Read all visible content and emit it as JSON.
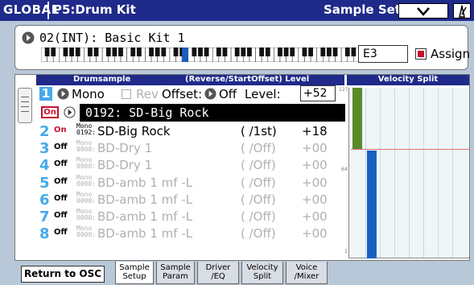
{
  "header": {
    "mode": "GLOBAL",
    "page": "P5:Drum Kit",
    "section": "Sample Setup"
  },
  "kit": {
    "name": "02(INT): Basic Kit 1",
    "key": "E3",
    "assign_label": "Assign"
  },
  "table": {
    "hdr_drumsample": "Drumsample",
    "hdr_reverse": "(Reverse/StartOffset) Level",
    "hdr_velocity": "Velocity Split"
  },
  "row1": {
    "number": "1",
    "mode": "Mono",
    "rev_label": "Rev",
    "offset_label": "Offset:",
    "offset_value": "Off",
    "level_label": "Level:",
    "level_value": "+52",
    "on_label": "On",
    "sample": "0192: SD-Big Rock"
  },
  "rows": [
    {
      "num": "2",
      "state": "On",
      "mode_small": "Mono",
      "id_small": "0192:",
      "name": "SD-Big Rock",
      "offset": "(  /1st)",
      "level": "+18"
    },
    {
      "num": "3",
      "state": "Off",
      "mode_small": "Mono",
      "id_small": "0000:",
      "name": "BD-Dry 1",
      "offset": "(  /Off)",
      "level": "+00"
    },
    {
      "num": "4",
      "state": "Off",
      "mode_small": "Mono",
      "id_small": "0000:",
      "name": "BD-Dry 1",
      "offset": "(  /Off)",
      "level": "+00"
    },
    {
      "num": "5",
      "state": "Off",
      "mode_small": "Mono",
      "id_small": "0000:",
      "name": "BD-amb 1 mf -L",
      "offset": "(  /Off)",
      "level": "+00"
    },
    {
      "num": "6",
      "state": "Off",
      "mode_small": "Mono",
      "id_small": "0000:",
      "name": "BD-amb 1 mf -L",
      "offset": "(  /Off)",
      "level": "+00"
    },
    {
      "num": "7",
      "state": "Off",
      "mode_small": "Mono",
      "id_small": "0000:",
      "name": "BD-amb 1 mf -L",
      "offset": "(  /Off)",
      "level": "+00"
    },
    {
      "num": "8",
      "state": "Off",
      "mode_small": "Mono",
      "id_small": "0000:",
      "name": "BD-amb 1 mf -L",
      "offset": "(  /Off)",
      "level": "+00"
    }
  ],
  "velocity": {
    "top_label": "127",
    "mid_label": "64",
    "bottom_label": "1"
  },
  "footer": {
    "return_label": "Return to OSC",
    "tabs": [
      {
        "label": "Sample Setup",
        "active": true
      },
      {
        "label": "Sample Param",
        "active": false
      },
      {
        "label": "Driver /EQ",
        "active": false
      },
      {
        "label": "Velocity Split",
        "active": false
      },
      {
        "label": "Voice /Mixer",
        "active": false
      }
    ]
  },
  "colors": {
    "header_bg": "#1f2a8a",
    "accent_blue": "#46a9ea",
    "on_red": "#c8102e",
    "muted_text": "#b0b0b0",
    "green_bar": "#5a8a2a",
    "blue_bar": "#1a5fc0"
  }
}
